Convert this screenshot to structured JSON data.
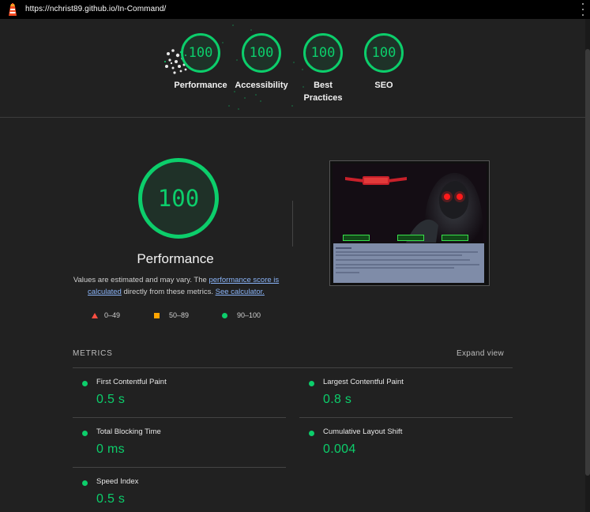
{
  "browser": {
    "url": "https://nchrist89.github.io/In-Command/"
  },
  "summary_gauges": [
    {
      "score": "100",
      "label": "Performance"
    },
    {
      "score": "100",
      "label": "Accessibility"
    },
    {
      "score": "100",
      "label": "Best Practices"
    },
    {
      "score": "100",
      "label": "SEO"
    }
  ],
  "performance": {
    "score": "100",
    "title": "Performance",
    "desc_prefix": "Values are estimated and may vary. The ",
    "link_score": "performance score is calculated",
    "desc_mid": " directly from these metrics. ",
    "link_calc": "See calculator.",
    "legend": [
      {
        "range": "0–49",
        "color": "#ff4e42"
      },
      {
        "range": "50–89",
        "color": "#ffa400"
      },
      {
        "range": "90–100",
        "color": "#0cce6b"
      }
    ]
  },
  "metrics": {
    "header": "METRICS",
    "expand_label": "Expand view",
    "items": [
      {
        "name": "First Contentful Paint",
        "value": "0.5 s"
      },
      {
        "name": "Largest Contentful Paint",
        "value": "0.8 s"
      },
      {
        "name": "Total Blocking Time",
        "value": "0 ms"
      },
      {
        "name": "Cumulative Layout Shift",
        "value": "0.004"
      },
      {
        "name": "Speed Index",
        "value": "0.5 s"
      }
    ]
  },
  "colors": {
    "pass": "#0cce6b",
    "average": "#ffa400",
    "fail": "#ff4e42",
    "background": "#212121"
  }
}
